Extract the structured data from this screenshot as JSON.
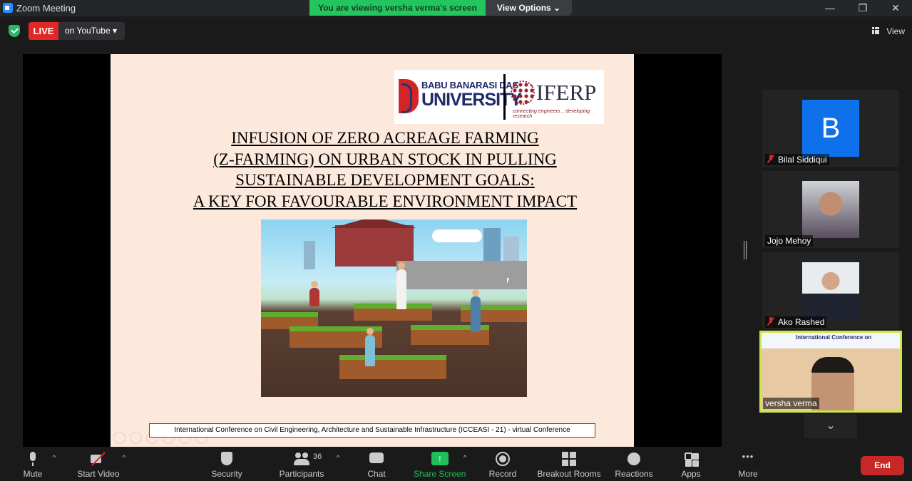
{
  "window": {
    "title": "Zoom Meeting",
    "viewing_prefix": "You are viewing ",
    "viewing_name": "versha verma's screen",
    "view_options": "View Options ⌄",
    "minimize": "—",
    "restore": "❐",
    "close": "✕"
  },
  "topbar": {
    "live_label": "LIVE",
    "live_destination": "on YouTube ▾",
    "view_label": "View"
  },
  "slide": {
    "logo_left_line1": "BABU BANARASI DAS",
    "logo_left_line2": "UNIVERSITY",
    "logo_right": "IFERP",
    "logo_right_tagline": "connecting engineers... developing research",
    "title_line1": "INFUSION OF ZERO ACREAGE FARMING",
    "title_line2": "(Z-FARMING) ON URBAN STOCK IN PULLING",
    "title_line3": "SUSTAINABLE DEVELOPMENT GOALS:",
    "title_line4": "A KEY FOR FAVOURABLE ENVIRONMENT IMPACT",
    "footer": "International Conference on Civil Engineering, Architecture and Sustainable Infrastructure (ICCEASI - 21) - virtual Conference"
  },
  "participants_panel": {
    "tiles": [
      {
        "name": "Bilal Siddiqui",
        "initial": "B",
        "muted": true
      },
      {
        "name": "Jojo Mehoy",
        "muted": false
      },
      {
        "name": "Ako Rashed",
        "muted": true
      }
    ],
    "active": {
      "name": "versha verma",
      "banner": "International Conference on"
    },
    "scroll_down": "⌄"
  },
  "toolbar": {
    "mute": "Mute",
    "start_video": "Start Video",
    "security": "Security",
    "participants": "Participants",
    "participant_count": "36",
    "chat": "Chat",
    "share_screen": "Share Screen",
    "record": "Record",
    "breakout_rooms": "Breakout Rooms",
    "reactions": "Reactions",
    "apps": "Apps",
    "more": "More",
    "end": "End",
    "caret": "^"
  },
  "colors": {
    "accent_green": "#23c55e",
    "live_red": "#e02828",
    "end_red": "#c62828",
    "active_border": "#cde64a",
    "zoom_blue": "#0e71eb"
  }
}
